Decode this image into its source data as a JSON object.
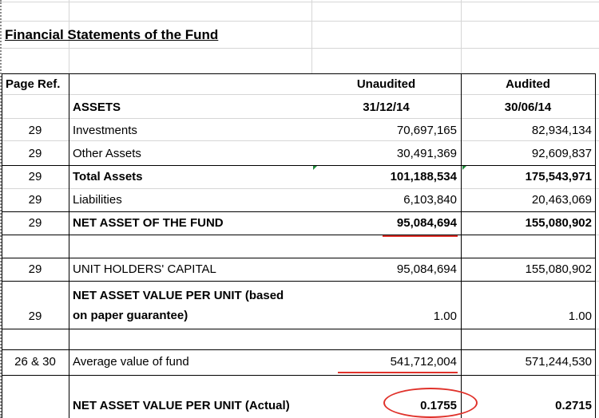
{
  "title": "Financial Statements of the Fund",
  "header": {
    "page_ref": "Page Ref.",
    "assets": "ASSETS",
    "col1_status": "Unaudited",
    "col1_date": "31/12/14",
    "col2_status": "Audited",
    "col2_date": "30/06/14"
  },
  "rows": [
    {
      "ref": "29",
      "label": "Investments",
      "v1": "70,697,165",
      "v2": "82,934,134"
    },
    {
      "ref": "29",
      "label": "Other Assets",
      "v1": "30,491,369",
      "v2": "92,609,837"
    },
    {
      "ref": "29",
      "label": "Total Assets",
      "v1": "101,188,534",
      "v2": "175,543,971"
    },
    {
      "ref": "29",
      "label": "Liabilities",
      "v1": "6,103,840",
      "v2": "20,463,069"
    },
    {
      "ref": "29",
      "label": "NET ASSET OF THE FUND",
      "v1": "95,084,694",
      "v2": "155,080,902"
    }
  ],
  "capital": {
    "ref": "29",
    "label": "UNIT HOLDERS' CAPITAL",
    "v1": "95,084,694",
    "v2": "155,080,902"
  },
  "navpu": {
    "ref": "29",
    "label_line1": "NET ASSET VALUE PER UNIT (based",
    "label_line2": "on paper guarantee)",
    "v1": "1.00",
    "v2": "1.00"
  },
  "average": {
    "ref": "26 & 30",
    "label": "Average value of fund",
    "v1": "541,712,004",
    "v2": "571,244,530"
  },
  "navpu_actual": {
    "label": "NET ASSET VALUE PER UNIT (Actual)",
    "v1": "0.1755",
    "v2": "0.2715"
  },
  "colors": {
    "annotation": "#e0322b",
    "grid": "#d6d6d6",
    "error_marker": "#1f8a3a"
  }
}
